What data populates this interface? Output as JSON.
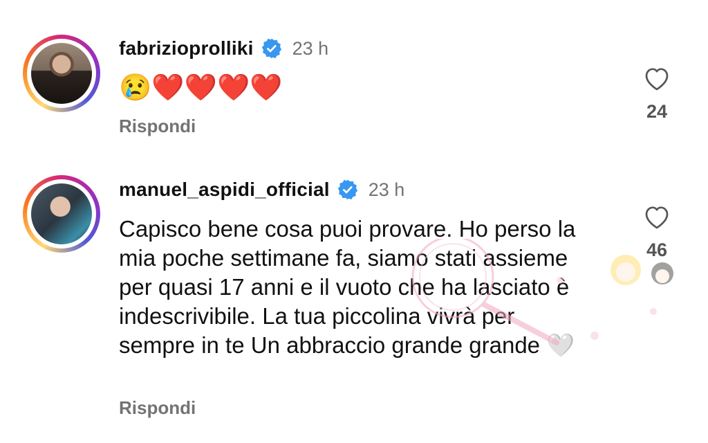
{
  "comments": [
    {
      "username": "fabrizioprolliki",
      "time": "23 h",
      "text": "😢❤️❤️❤️❤️",
      "reply_label": "Rispondi",
      "likes": "24"
    },
    {
      "username": "manuel_aspidi_official",
      "time": "23 h",
      "text": "Capisco bene cosa puoi provare. Ho perso la mia poche settimane fa, siamo stati assieme per quasi 17 anni e il vuoto che ha lasciato è indescrivibile. La tua piccolina vivrà per sempre in te Un abbraccio grande grande 🤍",
      "reply_label": "Rispondi",
      "likes": "46"
    }
  ],
  "colors": {
    "verified_badge": "#3897f0",
    "muted_text": "#737373",
    "primary_text": "#111111"
  },
  "icons": {
    "verified": "verified-badge-icon",
    "like": "heart-outline-icon"
  }
}
